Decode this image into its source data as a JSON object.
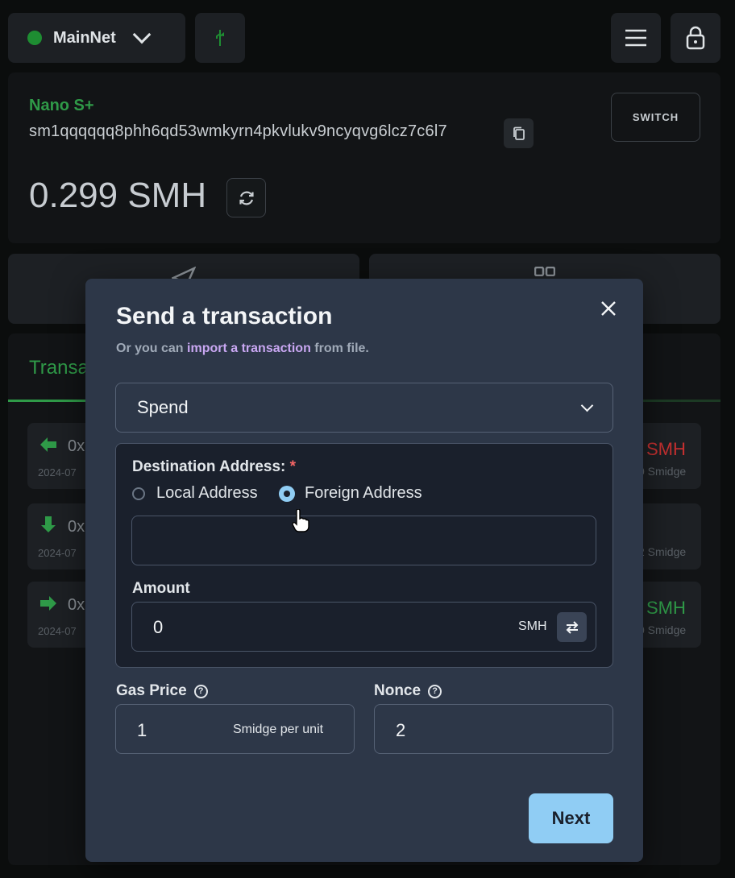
{
  "network": {
    "label": "MainNet",
    "status_color": "#1e8d32"
  },
  "wallet": {
    "device_name": "Nano S+",
    "address": "sm1qqqqqq8phh6qd53wmkyrn4pkvlukv9ncyqvg6lcz7c6l7",
    "switch_label": "SWITCH",
    "balance": "0.299 SMH"
  },
  "transactions": {
    "tab_label": "Transa",
    "rows": [
      {
        "hash": "0x",
        "date": "2024-07",
        "amount": "SMH",
        "amount_color": "#c53030",
        "sub": "0 Smidge",
        "arrow_icon": "arrow-left-icon"
      },
      {
        "hash": "0x",
        "date": "2024-07",
        "amount": "",
        "amount_color": "#8a9096",
        "sub": "2 Smidge",
        "arrow_icon": "arrow-down-icon"
      },
      {
        "hash": "0x",
        "date": "2024-07",
        "amount": "SMH",
        "amount_color": "#2f9a48",
        "sub": "0 Smidge",
        "arrow_icon": "arrow-right-icon"
      }
    ]
  },
  "modal": {
    "title": "Send a transaction",
    "subtitle_prefix": "Or you can ",
    "subtitle_link": "import a transaction",
    "subtitle_suffix": " from file.",
    "type_select": {
      "value": "Spend"
    },
    "destination": {
      "label": "Destination Address:",
      "required_mark": "*",
      "option_local": "Local Address",
      "option_foreign": "Foreign Address",
      "selected": "Foreign Address",
      "value": ""
    },
    "amount": {
      "label": "Amount",
      "value": "0",
      "unit": "SMH"
    },
    "gas_price": {
      "label": "Gas Price",
      "value": "1",
      "unit": "Smidge per unit"
    },
    "nonce": {
      "label": "Nonce",
      "value": "2"
    },
    "next_label": "Next"
  }
}
